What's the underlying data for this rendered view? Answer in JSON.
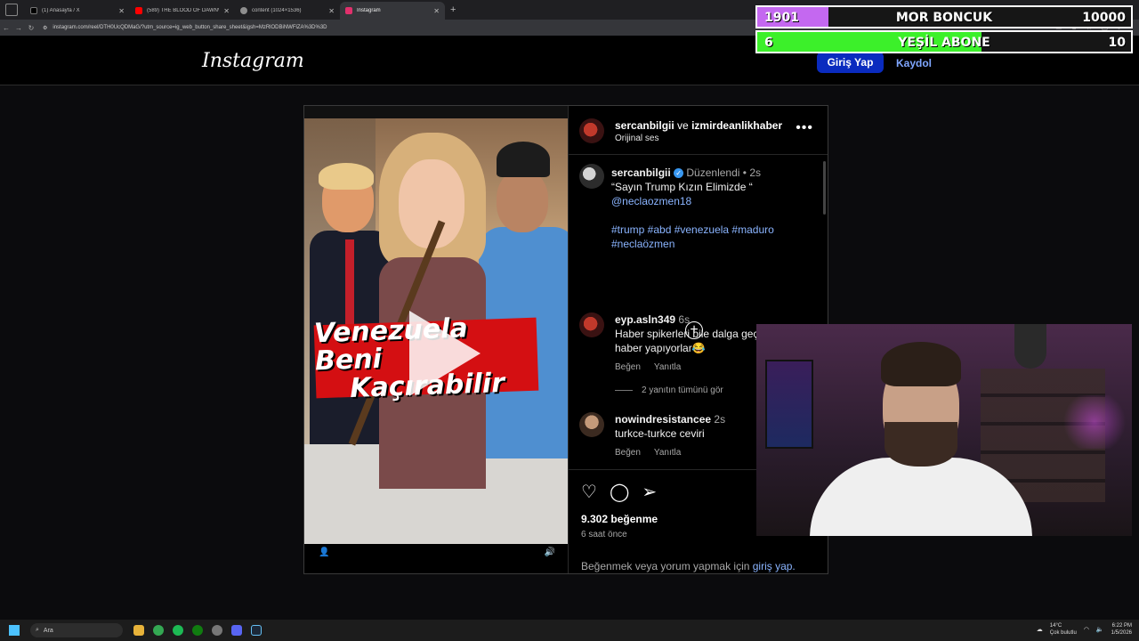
{
  "browser": {
    "tabs": [
      {
        "label": "(1) Anasayfa / X",
        "favicon_color": "#000000",
        "active": false
      },
      {
        "label": "(589) THE BLOOD OF DAWNW...",
        "favicon_color": "#ff0000",
        "active": false
      },
      {
        "label": "content (1024×1536)",
        "favicon_color": "#8e8e8e",
        "active": false
      },
      {
        "label": "Instagram",
        "favicon_color": "#e1306c",
        "active": true
      }
    ],
    "url": "instagram.com/reel/DTH0UcQDMaG/?utm_source=ig_web_button_share_sheet&igsh=MzRlODBiNWFlZA%3D%3D"
  },
  "overlay": {
    "bar1": {
      "left": "1901",
      "title": "MOR BONCUK",
      "right": "10000",
      "fill_fraction": 0.19,
      "color": "#c468f0"
    },
    "bar2": {
      "left": "6",
      "title": "YEŞİL ABONE",
      "right": "10",
      "fill_fraction": 0.6,
      "color": "#3cf02a"
    }
  },
  "header": {
    "logo": "Instagram",
    "login": "Giriş Yap",
    "signup": "Kaydol"
  },
  "video": {
    "caption_line1": "Venezuela Beni",
    "caption_line2": "Kaçırabilir"
  },
  "post": {
    "author": "sercanbilgii",
    "connector": "ve",
    "coauthor": "izmirdeanlikhaber",
    "audio": "Orijinal ses",
    "caption_author": "sercanbilgii",
    "edited": "Düzenlendi",
    "caption_time": "2s",
    "caption_text": "“Sayın Trump Kızın Elimizde “",
    "mention": "@neclaozmen18",
    "hashtags": "#trump #abd #venezuela #maduro #neclaözmen",
    "comments": [
      {
        "user": "eyp.asln349",
        "time": "6s",
        "text": "Haber spikerleri bile dalga geç... anlatıp haber yapıyorlar😂",
        "like": "Beğen",
        "reply": "Yanıtla"
      },
      {
        "user": "nowindresistancee",
        "time": "2s",
        "text": "turkce-turkce ceviri",
        "like": "Beğen",
        "reply": "Yanıtla"
      }
    ],
    "view_replies": "2 yanıtın tümünü gör",
    "likes": "9.302 beğenme",
    "posted": "6 saat önce",
    "login_prompt_prefix": "Beğenmek veya yorum yapmak için ",
    "login_prompt_link": "giriş yap."
  },
  "taskbar": {
    "search": "Ara",
    "temp": "14°C",
    "weather": "Çok bulutlu",
    "time": "6:22 PM",
    "date": "1/5/2026"
  }
}
